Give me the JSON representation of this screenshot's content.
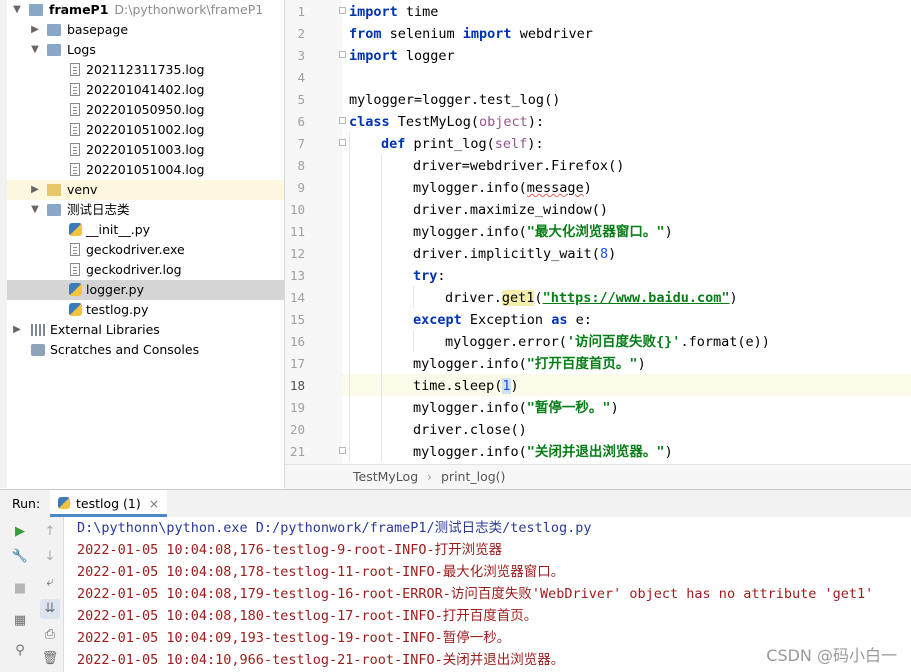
{
  "project": {
    "name": "frameP1",
    "path": "D:\\pythonwork\\frameP1",
    "items": [
      {
        "label": "basepage",
        "icon": "folder-icon"
      },
      {
        "label": "Logs",
        "icon": "folder-icon"
      },
      {
        "label": "202112311735.log",
        "icon": "log-file-icon"
      },
      {
        "label": "202201041402.log",
        "icon": "log-file-icon"
      },
      {
        "label": "202201050950.log",
        "icon": "log-file-icon"
      },
      {
        "label": "202201051002.log",
        "icon": "log-file-icon"
      },
      {
        "label": "202201051003.log",
        "icon": "log-file-icon"
      },
      {
        "label": "202201051004.log",
        "icon": "log-file-icon"
      },
      {
        "label": "venv",
        "icon": "folder-icon"
      },
      {
        "label": "测试日志类",
        "icon": "folder-icon"
      },
      {
        "label": "__init__.py",
        "icon": "python-file-icon"
      },
      {
        "label": "geckodriver.exe",
        "icon": "exe-file-icon"
      },
      {
        "label": "geckodriver.log",
        "icon": "log-file-icon"
      },
      {
        "label": "logger.py",
        "icon": "python-file-icon"
      },
      {
        "label": "testlog.py",
        "icon": "python-file-icon"
      },
      {
        "label": "External Libraries",
        "icon": "library-icon"
      },
      {
        "label": "Scratches and Consoles",
        "icon": "scratches-icon"
      }
    ]
  },
  "editor": {
    "line_numbers": [
      "1",
      "2",
      "3",
      "4",
      "5",
      "6",
      "7",
      "8",
      "9",
      "10",
      "11",
      "12",
      "13",
      "14",
      "15",
      "16",
      "17",
      "18",
      "19",
      "20",
      "21"
    ],
    "current_line": "18",
    "code": {
      "l1_kw": "import",
      "l1_rest": " time",
      "l2_kw1": "from",
      "l2_mid": " selenium ",
      "l2_kw2": "import",
      "l2_rest": " webdriver",
      "l3_kw": "import",
      "l3_rest": " logger",
      "l5": "mylogger=logger.test_log()",
      "l6_kw": "class",
      "l6_name": " TestMyLog(",
      "l6_obj": "object",
      "l6_end": "):",
      "l7_kw": "def",
      "l7_name": " print_log(",
      "l7_self": "self",
      "l7_end": "):",
      "l8": "driver=webdriver.Firefox()",
      "l9_a": "mylogger.info(",
      "l9_b": "message",
      "l9_c": ")",
      "l10": "driver.maximize_window()",
      "l11_a": "mylogger.info(",
      "l11_s": "\"最大化浏览器窗口。\"",
      "l11_c": ")",
      "l12_a": "driver.implicitly_wait(",
      "l12_n": "8",
      "l12_c": ")",
      "l13_kw": "try",
      "l13_c": ":",
      "l14_a": "driver.",
      "l14_m": "get1",
      "l14_p": "(",
      "l14_s": "\"https://www.baidu.com\"",
      "l14_c": ")",
      "l15_kw1": "except",
      "l15_mid": " Exception ",
      "l15_kw2": "as",
      "l15_c": " e:",
      "l16_a": "mylogger.error(",
      "l16_s": "'访问百度失败{}'",
      "l16_c": ".format(e))",
      "l17_a": "mylogger.info(",
      "l17_s": "\"打开百度首页。\"",
      "l17_c": ")",
      "l18_a": "time.sleep(",
      "l18_n": "1",
      "l18_c": ")",
      "l19_a": "mylogger.info(",
      "l19_s": "\"暂停一秒。\"",
      "l19_c": ")",
      "l20": "driver.close()",
      "l21_a": "mylogger.info(",
      "l21_s": "\"关闭并退出浏览器。\"",
      "l21_c": ")"
    }
  },
  "breadcrumb": {
    "class_name": "TestMyLog",
    "method_name": "print_log()"
  },
  "run": {
    "label": "Run:",
    "tab": "testlog (1)",
    "close": "×",
    "console": [
      "D:\\pythonn\\python.exe D:/pythonwork/frameP1/测试日志类/testlog.py",
      "2022-01-05 10:04:08,176-testlog-9-root-INFO-打开浏览器",
      "2022-01-05 10:04:08,178-testlog-11-root-INFO-最大化浏览器窗口。",
      "2022-01-05 10:04:08,179-testlog-16-root-ERROR-访问百度失败'WebDriver' object has no attribute 'get1'",
      "2022-01-05 10:04:08,180-testlog-17-root-INFO-打开百度首页。",
      "2022-01-05 10:04:09,193-testlog-19-root-INFO-暂停一秒。",
      "2022-01-05 10:04:10,966-testlog-21-root-INFO-关闭并退出浏览器。"
    ]
  },
  "watermark": "CSDN @码小白一",
  "colors": {
    "keyword": "#0033b3",
    "string": "#067d17",
    "self": "#94558d",
    "number": "#1750eb",
    "log_text": "#9c1b1b",
    "command": "#2a3a9a"
  }
}
